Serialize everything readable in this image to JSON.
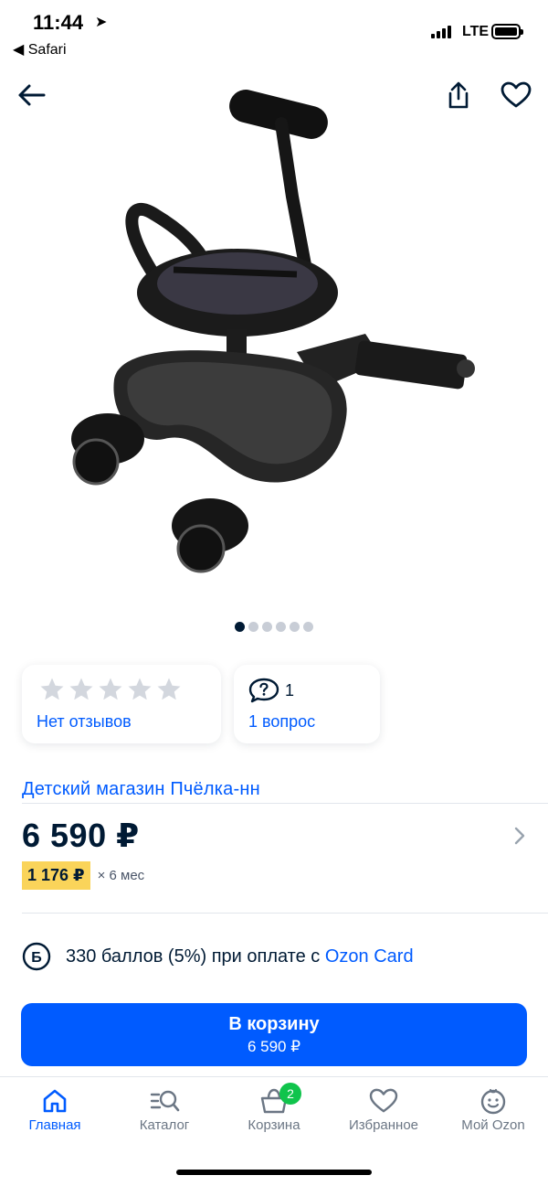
{
  "status_bar": {
    "time": "11:44",
    "back_app": "◀ Safari",
    "network": "LTE"
  },
  "icons": {
    "back": "back-arrow-icon",
    "share": "share-icon",
    "favorite": "heart-icon"
  },
  "gallery": {
    "image_alt": "product-photo-stroller-board",
    "total_images": 6,
    "active_index": 0
  },
  "reviews_card": {
    "rating_stars": 0,
    "max_stars": 5,
    "label": "Нет отзывов"
  },
  "questions_card": {
    "count": "1",
    "label": "1 вопрос"
  },
  "seller": {
    "name": "Детский магазин Пчёлка-нн"
  },
  "price": {
    "value": "6 590 ₽",
    "installment_amount": "1 176 ₽",
    "installment_term": "× 6 мес"
  },
  "bonus": {
    "badge": "Б",
    "text": "330 баллов (5%) при оплате с",
    "link": "Ozon Card"
  },
  "cart_button": {
    "label": "В корзину",
    "price": "6 590 ₽"
  },
  "tabbar": {
    "items": [
      {
        "label": "Главная",
        "icon": "home-icon",
        "active": true
      },
      {
        "label": "Каталог",
        "icon": "catalog-search-icon",
        "active": false
      },
      {
        "label": "Корзина",
        "icon": "cart-icon",
        "active": false,
        "badge": "2"
      },
      {
        "label": "Избранное",
        "icon": "heart-icon",
        "active": false
      },
      {
        "label": "Мой Ozon",
        "icon": "profile-smile-icon",
        "active": false
      }
    ]
  },
  "colors": {
    "accent": "#005bff",
    "installment_highlight": "#fad45a",
    "badge_green": "#10c44c",
    "text": "#001a34"
  }
}
